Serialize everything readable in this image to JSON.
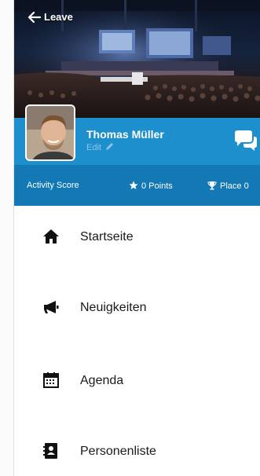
{
  "header": {
    "back_label": "Leave"
  },
  "profile": {
    "name": "Thomas Müller",
    "edit_label": "Edit"
  },
  "activity": {
    "score_label": "Activity Score",
    "points_label": "0 Points",
    "place_label": "Place 0"
  },
  "menu": {
    "items": [
      {
        "label": "Startseite",
        "icon": "home-icon"
      },
      {
        "label": "Neuigkeiten",
        "icon": "megaphone-icon"
      },
      {
        "label": "Agenda",
        "icon": "calendar-icon"
      },
      {
        "label": "Personenliste",
        "icon": "contacts-book-icon"
      }
    ]
  },
  "colors": {
    "profile_bar": "#1c8fcc",
    "activity_bar": "#1378b4"
  }
}
